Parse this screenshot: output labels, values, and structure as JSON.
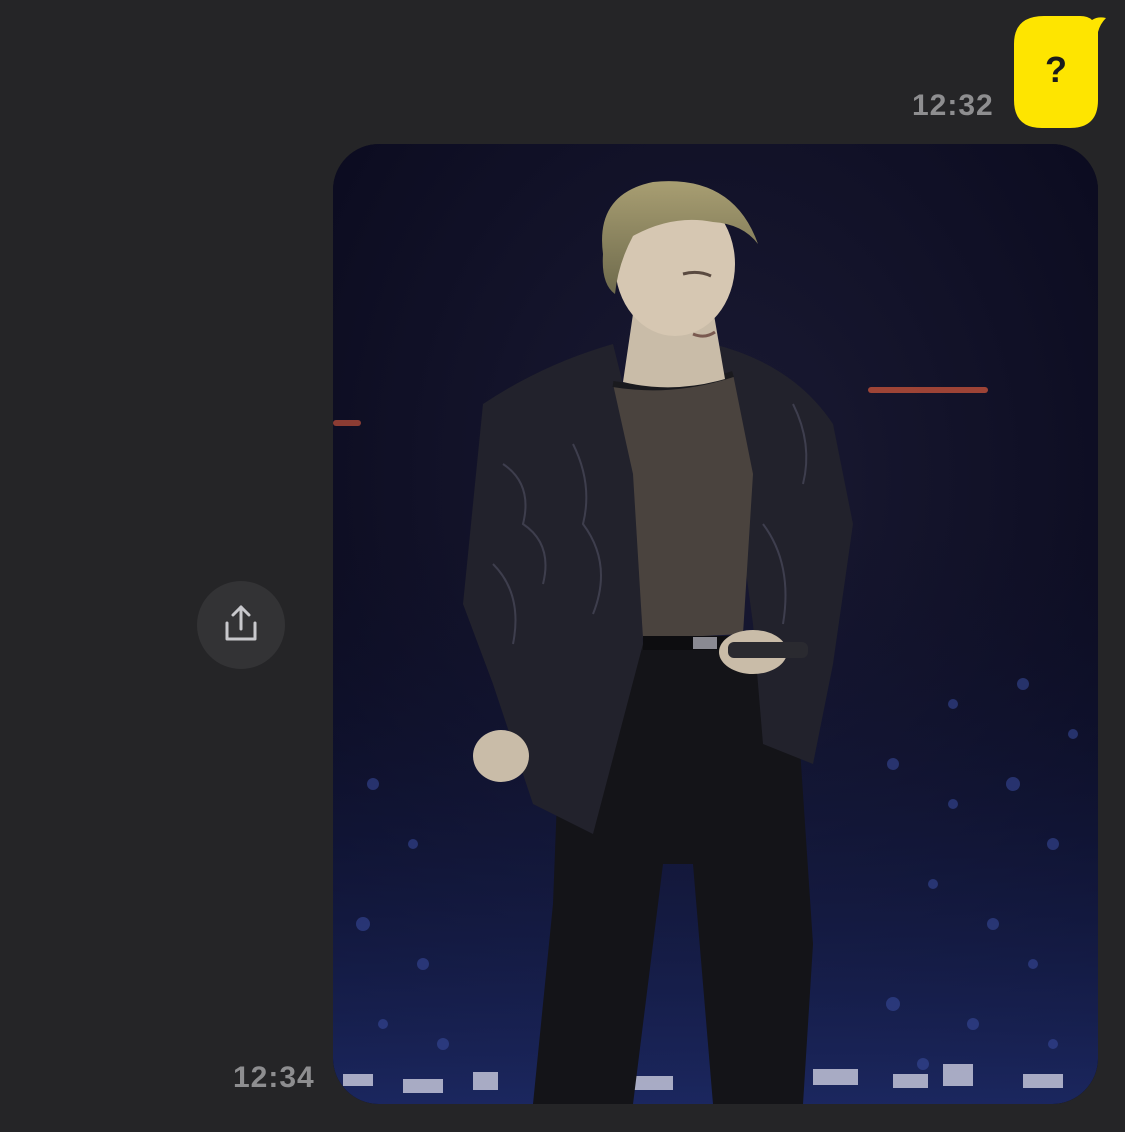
{
  "messages": {
    "sent": {
      "text": "?",
      "time": "12:32"
    },
    "received": {
      "time": "12:34",
      "attachment": "photo"
    }
  },
  "share": {
    "icon": "share-icon"
  },
  "colors": {
    "background": "#252527",
    "sent_bubble": "#FEE500",
    "timestamp": "#8E8E90",
    "share_button": "#333335"
  }
}
